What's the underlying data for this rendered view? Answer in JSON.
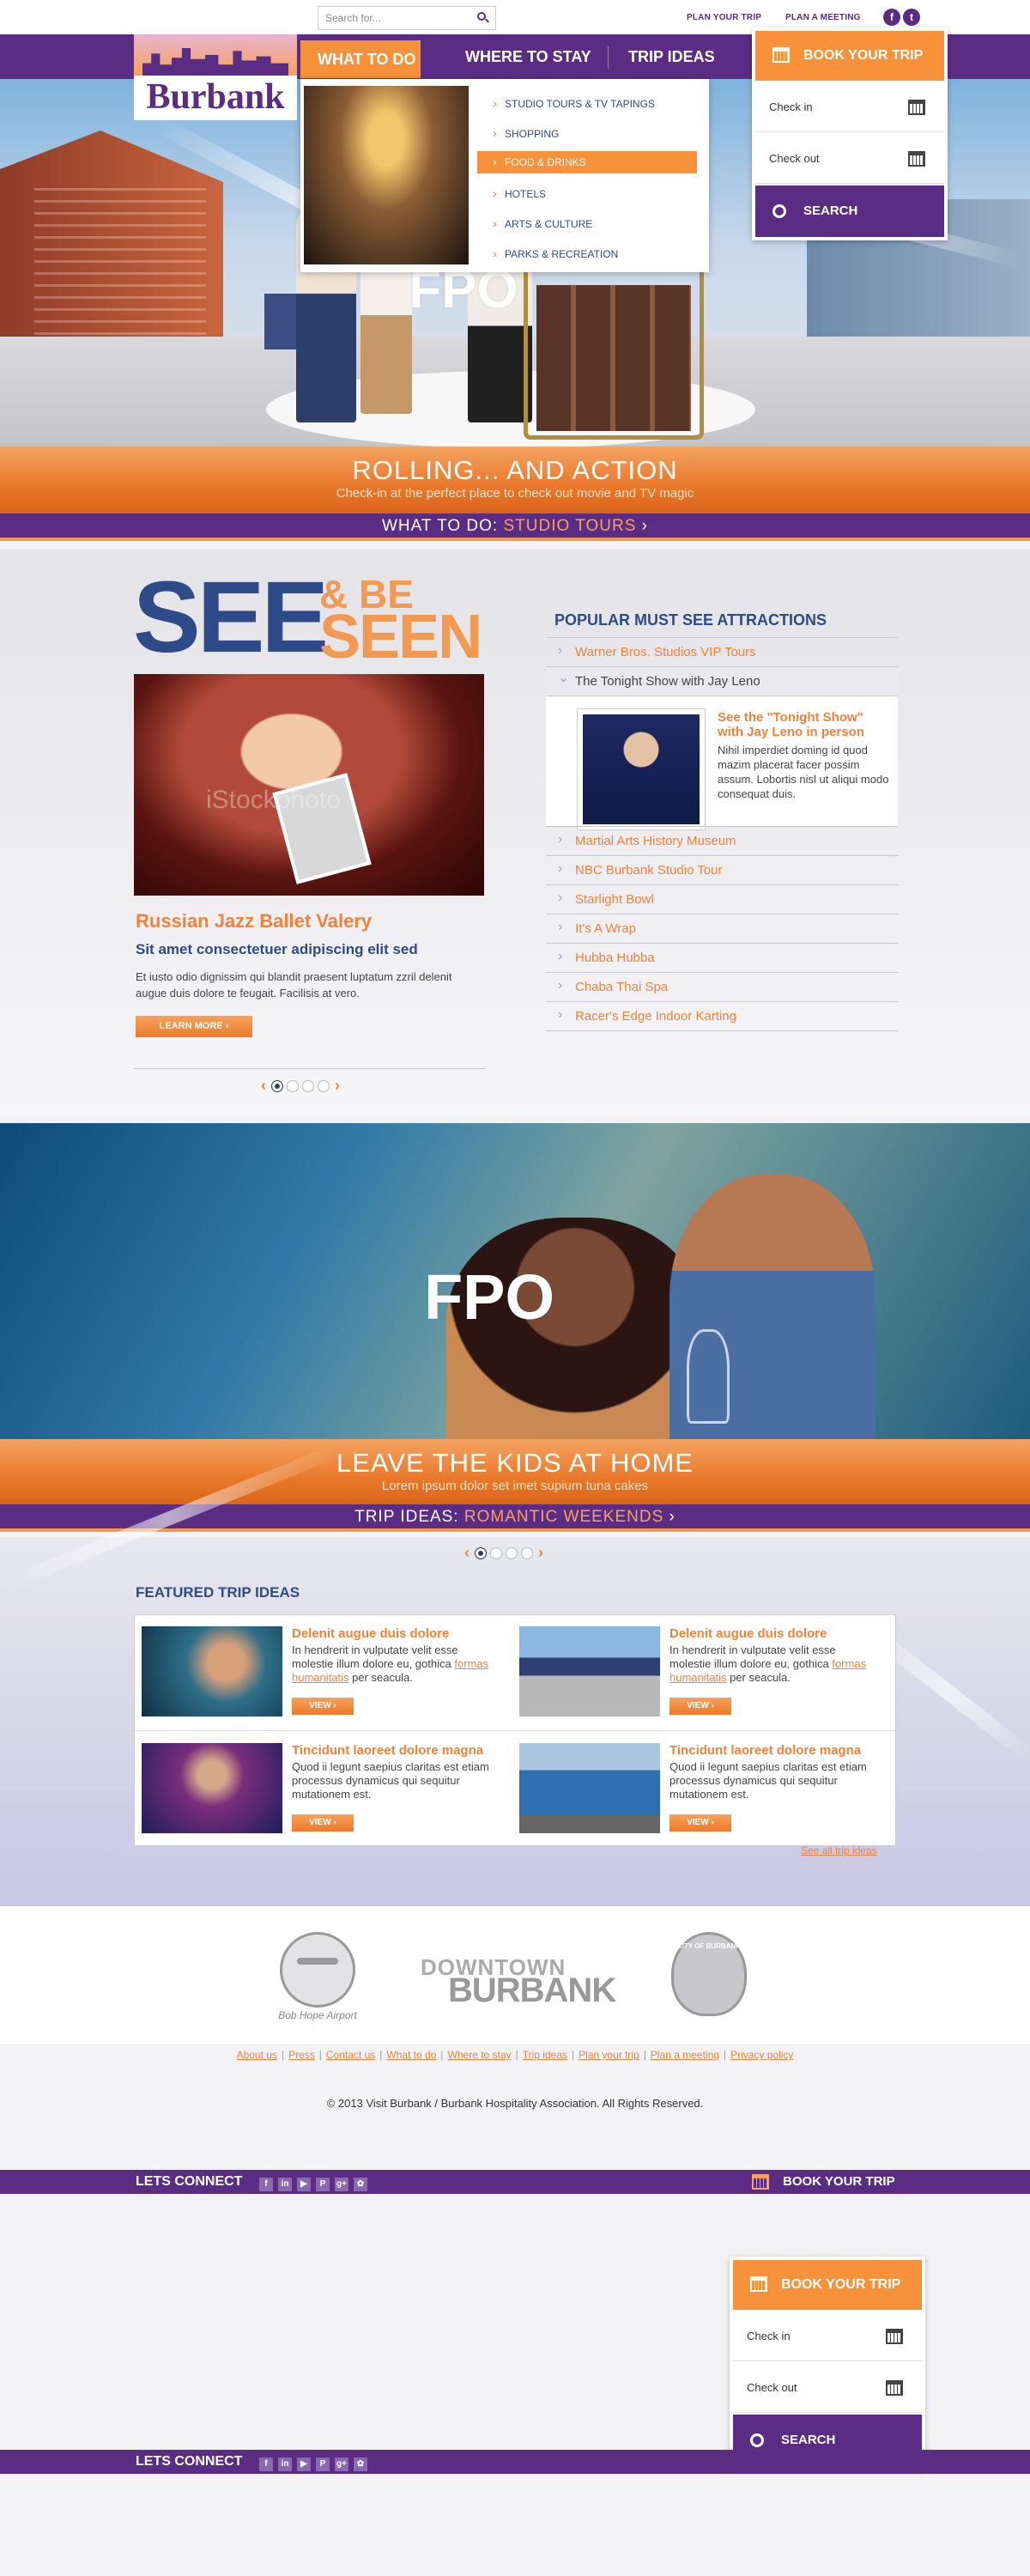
{
  "header": {
    "search_placeholder": "Search for...",
    "plan_trip": "PLAN YOUR TRIP",
    "plan_meeting": "PLAN A MEETING",
    "social": [
      "f",
      "t"
    ]
  },
  "logo": {
    "text": "Burbank"
  },
  "nav": {
    "active": "WHAT TO DO",
    "items": [
      "WHERE TO STAY",
      "TRIP IDEAS"
    ]
  },
  "dropdown": {
    "items": [
      {
        "label": "STUDIO TOURS & TV TAPINGS",
        "active": false
      },
      {
        "label": "SHOPPING",
        "active": false
      },
      {
        "label": "FOOD & DRINKS",
        "active": true
      },
      {
        "label": "HOTELS",
        "active": false
      },
      {
        "label": "ARTS & CULTURE",
        "active": false
      },
      {
        "label": "PARKS & RECREATION",
        "active": false
      }
    ]
  },
  "booking": {
    "title": "BOOK YOUR TRIP",
    "check_in": "Check in",
    "check_out": "Check out",
    "search": "SEARCH"
  },
  "hero": {
    "fpo": "FPO",
    "title": "ROLLING... AND ACTION",
    "subtitle": "Check-in at the perfect place to check out movie and TV magic",
    "tag_label": "WHAT TO DO:",
    "tag_value": "STUDIO TOURS",
    "tag_arrow": "›"
  },
  "see_be_seen": {
    "see": "SEE",
    "be": "& BE",
    "seen": "SEEN",
    "watermark": "iStockphoto",
    "title": "Russian Jazz Ballet Valery",
    "subtitle": "Sit amet consectetuer adipiscing elit sed",
    "body": "Et iusto odio dignissim qui blandit praesent luptatum zzril delenit augue duis dolore te feugait. Facilisis at vero.",
    "button": "LEARN MORE ›"
  },
  "attractions": {
    "heading": "POPULAR MUST SEE ATTRACTIONS",
    "before": [
      "Warner Bros. Studios VIP Tours"
    ],
    "open": "The Tonight Show with Jay Leno",
    "detail_title": "See the \"Tonight Show\" with Jay Leno in person",
    "detail_body": "Nihil imperdiet doming id quod mazim placerat facer possim assum. Lobortis nisl ut aliqui modo consequat duis.",
    "after": [
      "Martial Arts History Museum",
      "NBC Burbank Studio Tour",
      "Starlight Bowl",
      "It's A Wrap",
      "Hubba Hubba",
      "Chaba Thai Spa",
      "Racer's Edge Indoor Karting"
    ]
  },
  "romance": {
    "fpo": "FPO",
    "title": "LEAVE THE KIDS AT HOME",
    "subtitle": "Lorem ipsum dolor set imet supium tuna cakes",
    "tag_label": "TRIP IDEAS:",
    "tag_value": "ROMANTIC WEEKENDS",
    "tag_arrow": "›"
  },
  "featured": {
    "heading": "FEATURED TRIP IDEAS",
    "cards": [
      {
        "title": "Delenit augue duis dolore",
        "body": "In hendrerit in vulputate velit esse molestie illum dolore eu, gothica",
        "link": "formas humanitatis",
        "tail": " per seacula.",
        "button": "VIEW ›"
      },
      {
        "title": "Delenit augue duis dolore",
        "body": "In hendrerit in vulputate velit esse molestie illum dolore eu, gothica",
        "link": "formas humanitatis",
        "tail": " per seacula.",
        "button": "VIEW ›"
      },
      {
        "title": "Tincidunt laoreet dolore magna",
        "body": "Quod ii legunt saepius claritas est etiam processus dynamicus qui sequitur mutationem est.",
        "link": "",
        "tail": "",
        "button": "VIEW ›"
      },
      {
        "title": "Tincidunt laoreet dolore magna",
        "body": "Quod ii legunt saepius claritas est etiam processus dynamicus qui sequitur mutationem est.",
        "link": "",
        "tail": "",
        "button": "VIEW ›"
      }
    ],
    "see_all": "See all trip ideas"
  },
  "partners": {
    "airport": "Bob Hope Airport",
    "downtown_1": "DOWNTOWN",
    "downtown_2": "BURBANK",
    "city_seal": "CITY OF BURBANK"
  },
  "footer": {
    "links": [
      "About us",
      "Press",
      "Contact us",
      "What to do",
      "Where to stay",
      "Trip ideas",
      "Plan your trip",
      "Plan a meeting",
      "Privacy policy"
    ],
    "copyright": "© 2013 Visit Burbank / Burbank Hospitality Association. All Rights Reserved.",
    "connect": "LETS CONNECT",
    "social_icons": [
      "f",
      "in",
      "▶",
      "P",
      "g+",
      "✿"
    ],
    "book": "BOOK YOUR TRIP"
  },
  "colors": {
    "purple": "#5b2c83",
    "orange": "#f7923a",
    "navy": "#2e4a89"
  }
}
